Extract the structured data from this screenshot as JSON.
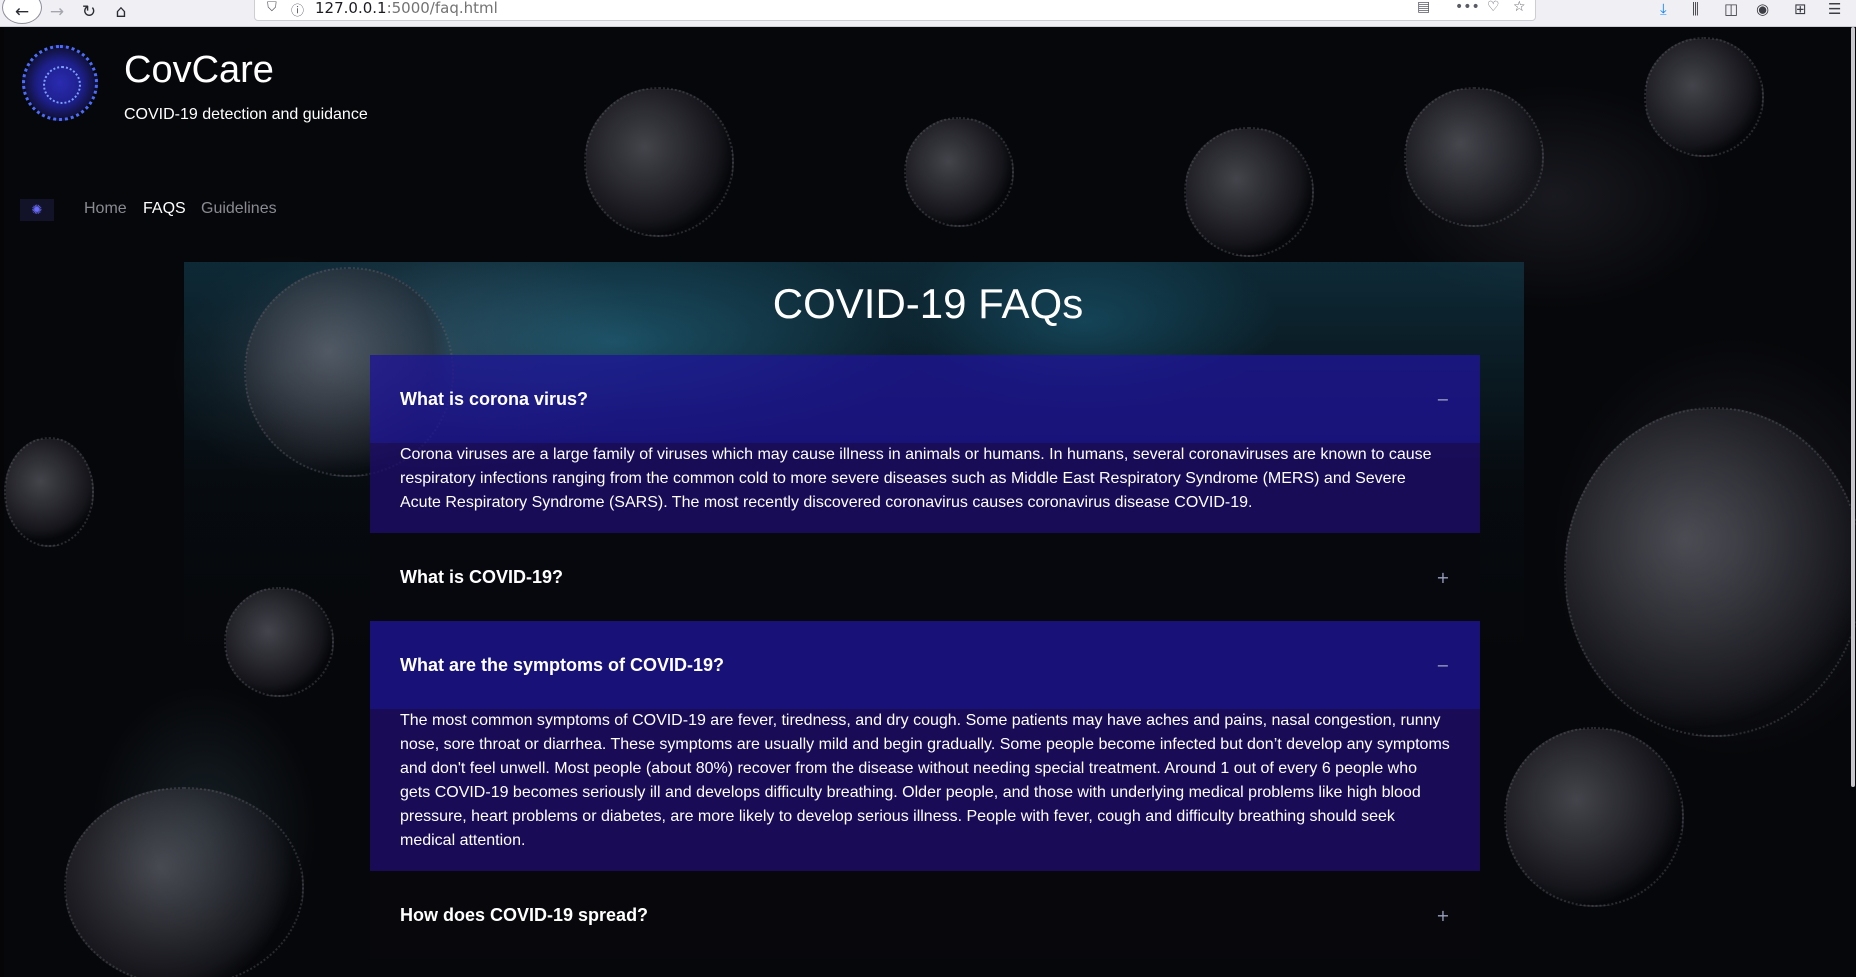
{
  "browser": {
    "url_host": "127.0.0.1",
    "url_path": ":5000/faq.html"
  },
  "site": {
    "title": "CovCare",
    "subtitle": "COVID-19 detection and guidance"
  },
  "nav": {
    "links": [
      {
        "label": "Home",
        "active": false
      },
      {
        "label": "FAQS",
        "active": true
      },
      {
        "label": "Guidelines",
        "active": false
      }
    ]
  },
  "faq": {
    "title": "COVID-19 FAQs",
    "items": [
      {
        "question": "What is corona virus?",
        "open": true,
        "toggle": "−",
        "answer": "Corona viruses are a large family of viruses which may cause illness in animals or humans. In humans, several coronaviruses are known to cause respiratory infections ranging from the common cold to more severe diseases such as Middle East Respiratory Syndrome (MERS) and Severe Acute Respiratory Syndrome (SARS). The most recently discovered coronavirus causes coronavirus disease COVID-19."
      },
      {
        "question": "What is COVID-19?",
        "open": false,
        "toggle": "+"
      },
      {
        "question": "What are the symptoms of COVID-19?",
        "open": true,
        "toggle": "−",
        "answer": "The most common symptoms of COVID-19 are fever, tiredness, and dry cough. Some patients may have aches and pains, nasal congestion, runny nose, sore throat or diarrhea. These symptoms are usually mild and begin gradually. Some people become infected but don’t develop any symptoms and don't feel unwell. Most people (about 80%) recover from the disease without needing special treatment. Around 1 out of every 6 people who gets COVID-19 becomes seriously ill and develops difficulty breathing. Older people, and those with underlying medical problems like high blood pressure, heart problems or diabetes, are more likely to develop serious illness. People with fever, cough and difficulty breathing should seek medical attention."
      },
      {
        "question": "How does COVID-19 spread?",
        "open": false,
        "toggle": "+"
      }
    ]
  }
}
